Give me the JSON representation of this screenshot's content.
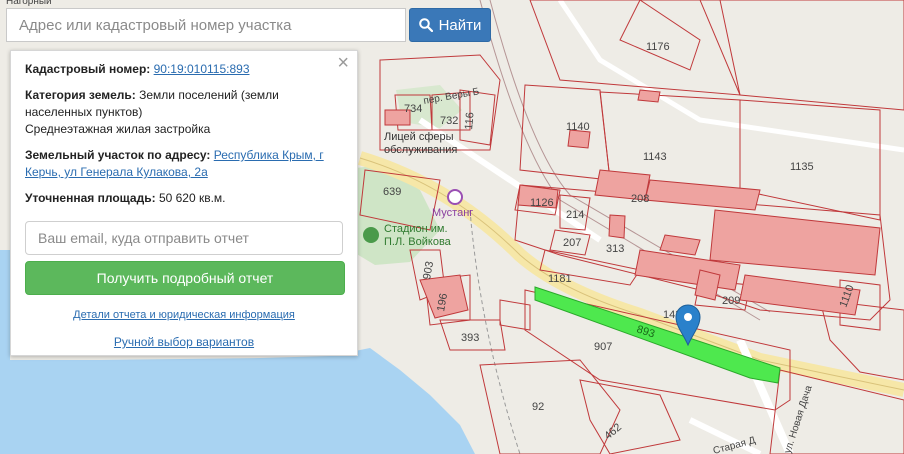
{
  "search": {
    "placeholder": "Адрес или кадастровый номер участка",
    "button_label": "Найти"
  },
  "info_panel": {
    "cadastral_label": "Кадастровый номер:",
    "cadastral_value": "90:19:010115:893",
    "category_label": "Категория земель:",
    "category_value": "Земли поселений (земли населенных пунктов)",
    "usage_value": "Среднеэтажная жилая застройка",
    "address_label": "Земельный участок по адресу:",
    "address_value": "Республика Крым, г Керчь, ул Генерала Кулакова, 2а",
    "area_label": "Уточненная площадь:",
    "area_value": "50 620 кв.м.",
    "email_placeholder": "Ваш email, куда отправить отчет",
    "report_button": "Получить подробный отчет",
    "details_link": "Детали отчета и юридическая информация",
    "manual_link": "Ручной выбор вариантов"
  },
  "map": {
    "parcels": [
      "1176",
      "1140",
      "1143",
      "1135",
      "734",
      "732",
      "116",
      "639",
      "1126",
      "214",
      "208",
      "207",
      "313",
      "1181",
      "903",
      "196",
      "393",
      "907",
      "893",
      "209",
      "1110",
      "92",
      "462",
      "143"
    ],
    "street_labels": [
      "пер. Веры Б",
      "ул. Новая Дача",
      "Старая Д"
    ],
    "poi_labels": [
      "Лицей сферы обслуживания",
      "Мустанг",
      "Стадион им. П.Л. Войкова"
    ],
    "top_fragment": "Нагорный",
    "highlight_color": "#4ee84e",
    "marker_color": "#2a81cb"
  }
}
